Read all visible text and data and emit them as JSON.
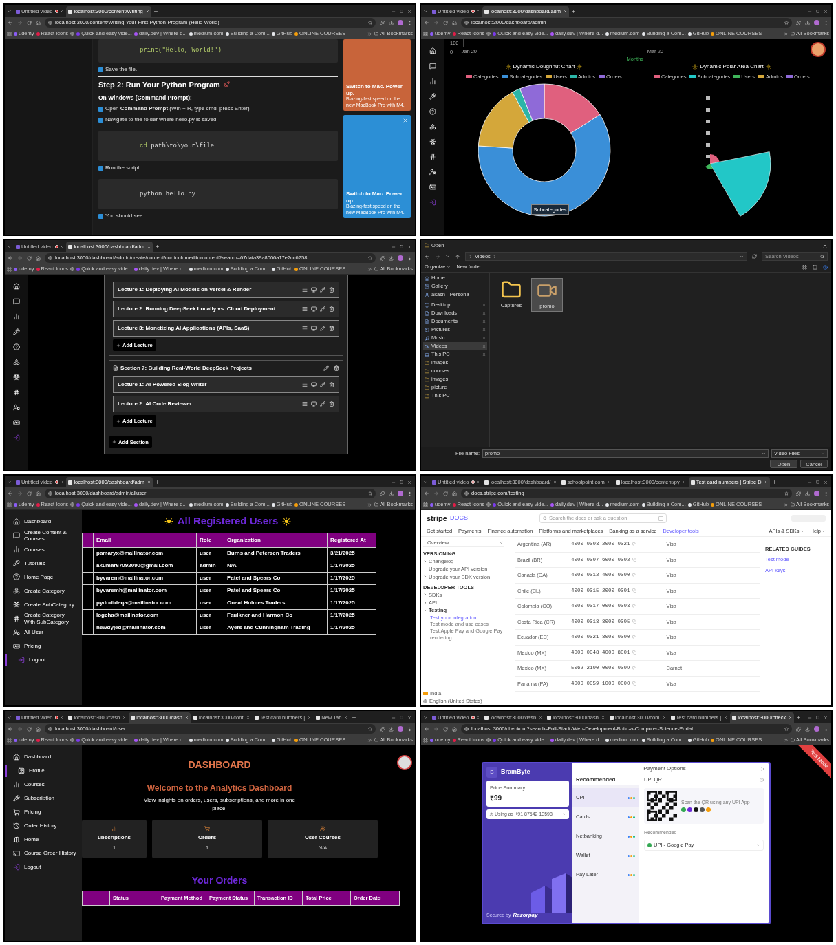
{
  "panels": [
    {
      "kind": "tutorial",
      "browser": {
        "tabs": [
          {
            "title": "Untitled video",
            "selected": false,
            "recording": true
          },
          {
            "title": "localhost:3000/content/Writing",
            "selected": true,
            "recording": false
          }
        ],
        "url": "localhost:3000/content/Writing-Your-First-Python-Program-(Hello-World)",
        "bookmarks": [
          "udemy",
          "React Icons",
          "Quick and easy vide...",
          "daily.dev | Where d...",
          "medium.com",
          "Building a Com...",
          "GitHub",
          "ONLINE COURSES"
        ],
        "all_bookmarks": "All Bookmarks"
      },
      "blocks": [
        {
          "kind": "code",
          "tokens": [
            {
              "text": "print(\"Hello, World!\")",
              "keyword": true
            }
          ]
        },
        {
          "kind": "step",
          "text": "Save the file."
        },
        {
          "kind": "heading",
          "text": "Step 2: Run Your Python Program"
        },
        {
          "kind": "subheading",
          "text": "On Windows (Command Prompt):"
        },
        {
          "kind": "step",
          "text": "Open **Command Prompt** (Win + R, type cmd, press Enter)."
        },
        {
          "kind": "step",
          "text": "Navigate to the folder where hello.py is saved:"
        },
        {
          "kind": "code",
          "tokens": [
            {
              "text": "cd",
              "keyword": true
            },
            {
              "text": " path\\to\\your\\file",
              "keyword": false
            }
          ]
        },
        {
          "kind": "step",
          "text": "Run the script:"
        },
        {
          "kind": "code",
          "tokens": [
            {
              "text": "python hello.py",
              "keyword": false
            }
          ]
        },
        {
          "kind": "step",
          "text": "You should see:"
        }
      ],
      "ads": [
        {
          "title": "Switch to Mac. Power up.",
          "text": "Blazing-fast speed on the new MacBook Pro with M4.",
          "closable": false
        },
        {
          "title": "Switch to Mac. Power up.",
          "text": "Blazing-fast speed on the new MacBook Pro with M4.",
          "closable": true
        }
      ]
    },
    {
      "kind": "charts",
      "browser": {
        "tabs": [
          {
            "title": "Untitled video",
            "selected": false,
            "recording": true
          },
          {
            "title": "localhost:3000/dashboard/adm",
            "selected": true,
            "recording": false
          }
        ],
        "url": "localhost:3000/dashboard/admin",
        "bookmarks": [
          "udemy",
          "React Icons",
          "Quick and easy vide...",
          "daily.dev | Where d...",
          "medium.com",
          "Building a Com...",
          "GitHub",
          "ONLINE COURSES"
        ],
        "all_bookmarks": "All Bookmarks"
      },
      "top_chart": {
        "yticks": [
          "100",
          "0"
        ],
        "xticks": [
          "Jan 20",
          "Mar 20"
        ],
        "xlabel": "Months"
      },
      "charts": [
        {
          "kind": "donut",
          "title": "Dynamic Doughnut Chart",
          "tooltip": "Subcategories",
          "legend": [
            {
              "label": "Categories",
              "color": "#e0607e"
            },
            {
              "label": "Subcategories",
              "color": "#3a8fd8"
            },
            {
              "label": "Users",
              "color": "#d4a73a"
            },
            {
              "label": "Admins",
              "color": "#2bb5a8"
            },
            {
              "label": "Orders",
              "color": "#8f6ad8"
            }
          ]
        },
        {
          "kind": "polar",
          "title": "Dynamic Polar Area Chart",
          "legend": [
            {
              "label": "Categories",
              "color": "#e0607e"
            },
            {
              "label": "Subcategories",
              "color": "#22c7c7"
            },
            {
              "label": "Users",
              "color": "#3fb55a"
            },
            {
              "label": "Admins",
              "color": "#d4a73a"
            },
            {
              "label": "Orders",
              "color": "#8f6ad8"
            }
          ]
        }
      ]
    },
    {
      "kind": "curriculum",
      "browser": {
        "tabs": [
          {
            "title": "Untitled video",
            "selected": false,
            "recording": true
          },
          {
            "title": "localhost:3000/dashboard/adm",
            "selected": true,
            "recording": false
          }
        ],
        "url": "localhost:3000/dashboard/admin/create/content/curriculumeditorcontent?search=67dafa39a8006a17e2cc6258",
        "bookmarks": [
          "udemy",
          "React Icons",
          "Quick and easy vide...",
          "daily.dev | Where d...",
          "medium.com",
          "Building a Com...",
          "GitHub",
          "ONLINE COURSES"
        ],
        "all_bookmarks": "All Bookmarks"
      },
      "sections": [
        {
          "lectures": [
            "Lecture 1: Deploying AI Models on Vercel & Render",
            "Lecture 2: Running DeepSeek Locally vs. Cloud Deployment",
            "Lecture 3: Monetizing AI Applications (APIs, SaaS)"
          ],
          "add_lecture": "Add Lecture"
        },
        {
          "title": "Section 7: Building Real-World DeepSeek Projects",
          "lectures": [
            "Lecture 1: AI-Powered Blog Writer",
            "Lecture 2: AI Code Reviewer"
          ],
          "add_lecture": "Add Lecture"
        }
      ],
      "add_section": "Add Section"
    },
    {
      "kind": "file_dialog",
      "title": "Open",
      "path": "Videos",
      "search_placeholder": "Search Videos",
      "toolbar": [
        "Organize",
        "New folder"
      ],
      "nav": [
        {
          "label": "Home",
          "selected": false,
          "pinned": false
        },
        {
          "label": "Gallery",
          "selected": false,
          "pinned": false
        },
        {
          "label": "akash - Persona",
          "selected": false,
          "pinned": false
        },
        {
          "label": "Desktop",
          "selected": false,
          "pinned": true
        },
        {
          "label": "Downloads",
          "selected": false,
          "pinned": true
        },
        {
          "label": "Documents",
          "selected": false,
          "pinned": true
        },
        {
          "label": "Pictures",
          "selected": false,
          "pinned": true
        },
        {
          "label": "Music",
          "selected": false,
          "pinned": true
        },
        {
          "label": "Videos",
          "selected": true,
          "pinned": true
        },
        {
          "label": "This PC",
          "selected": false,
          "pinned": true
        },
        {
          "label": "images",
          "selected": false,
          "pinned": false
        },
        {
          "label": "courses",
          "selected": false,
          "pinned": false
        },
        {
          "label": "images",
          "selected": false,
          "pinned": false
        },
        {
          "label": "picture",
          "selected": false,
          "pinned": false
        },
        {
          "label": "This PC",
          "selected": false,
          "pinned": false
        }
      ],
      "files": [
        {
          "name": "Captures",
          "kind": "folder",
          "selected": false
        },
        {
          "name": "promo",
          "kind": "video",
          "selected": true
        }
      ],
      "file_name_label": "File name:",
      "file_name": "promo",
      "file_type": "Video Files",
      "buttons": [
        "Open",
        "Cancel"
      ]
    },
    {
      "kind": "users",
      "browser": {
        "tabs": [
          {
            "title": "Untitled video",
            "selected": false,
            "recording": true
          },
          {
            "title": "localhost:3000/dashboard/adm",
            "selected": true,
            "recording": false
          }
        ],
        "url": "localhost:3000/dashboard/admin/alluser",
        "bookmarks": [
          "udemy",
          "React Icons",
          "Quick and easy vide...",
          "daily.dev | Where d...",
          "medium.com",
          "Building a Com...",
          "GitHub",
          "ONLINE COURSES"
        ],
        "all_bookmarks": "All Bookmarks"
      },
      "sidebar": [
        {
          "label": "Dashboard",
          "selected": false
        },
        {
          "label": "Create Content & Courses",
          "selected": false
        },
        {
          "label": "Courses",
          "selected": false
        },
        {
          "label": "Tutorials",
          "selected": false
        },
        {
          "label": "Home Page",
          "selected": false
        },
        {
          "label": "Create Category",
          "selected": false
        },
        {
          "label": "Create SubCategory",
          "selected": false
        },
        {
          "label": "Create Category With SubCategory",
          "selected": false
        },
        {
          "label": "All User",
          "selected": false
        },
        {
          "label": "Pricing",
          "selected": false
        },
        {
          "label": "Logout",
          "selected": true
        }
      ],
      "title": "All Registered Users",
      "table": {
        "columns": [
          "Email",
          "Role",
          "Organization",
          "Registered At"
        ],
        "rows": [
          [
            "pamaryx@mailinator.com",
            "user",
            "Burns and Petersen Traders",
            "3/21/2025"
          ],
          [
            "akumar67092090@gmail.com",
            "admin",
            "N/A",
            "1/17/2025"
          ],
          [
            "byvarem@mailinator.com",
            "user",
            "Patel and Spears Co",
            "1/17/2025"
          ],
          [
            "byvaremh@mailinator.com",
            "user",
            "Patel and Spears Co",
            "1/17/2025"
          ],
          [
            "pydodideqa@mailinator.com",
            "user",
            "Oneal Holmes Traders",
            "1/17/2025"
          ],
          [
            "logcha@mailinator.com",
            "user",
            "Faulkner and Harmon Co",
            "1/17/2025"
          ],
          [
            "hewdyjed@mailinator.com",
            "user",
            "Ayers and Cunningham Trading",
            "1/17/2025"
          ]
        ]
      }
    },
    {
      "kind": "stripe",
      "browser": {
        "tabs": [
          {
            "title": "Untitled video",
            "selected": false,
            "recording": true
          },
          {
            "title": "localhost:3000/dashboard/",
            "selected": false,
            "recording": false
          },
          {
            "title": "schoolpoint.com",
            "selected": false,
            "recording": false
          },
          {
            "title": "localhost:3000/content/py",
            "selected": false,
            "recording": false
          },
          {
            "title": "Test card numbers | Stripe D",
            "selected": true,
            "recording": false
          }
        ],
        "url": "docs.stripe.com/testing",
        "bookmarks": [
          "udemy",
          "React Icons",
          "Quick and easy vide...",
          "daily.dev | Where d...",
          "medium.com",
          "Building a Com...",
          "GitHub",
          "ONLINE COURSES"
        ],
        "all_bookmarks": "All Bookmarks"
      },
      "logo": "stripe",
      "logo_suffix": "DOCS",
      "search_placeholder": "Search the docs or ask a question",
      "nav": [
        {
          "label": "Get started",
          "selected": false
        },
        {
          "label": "Payments",
          "selected": false
        },
        {
          "label": "Finance automation",
          "selected": false
        },
        {
          "label": "Platforms and marketplaces",
          "selected": false
        },
        {
          "label": "Banking as a service",
          "selected": false
        },
        {
          "label": "Developer tools",
          "selected": true
        }
      ],
      "nav_right": [
        "APIs & SDKs",
        "Help"
      ],
      "sidebar": {
        "overview": "Overview",
        "groups": [
          {
            "title": "VERSIONING",
            "items": [
              {
                "label": "Changelog",
                "expanded": false
              },
              {
                "label": "Upgrade your API version"
              },
              {
                "label": "Upgrade your SDK version",
                "expanded": false
              }
            ]
          },
          {
            "title": "DEVELOPER TOOLS",
            "items": [
              {
                "label": "SDKs",
                "expanded": false
              },
              {
                "label": "API",
                "expanded": false
              },
              {
                "label": "Testing",
                "expanded": true,
                "children": [
                  {
                    "label": "Test your integration",
                    "selected": true
                  },
                  {
                    "label": "Test mode and use cases",
                    "selected": false
                  },
                  {
                    "label": "Test Apple Pay and Google Pay rendering",
                    "selected": false
                  }
                ]
              }
            ]
          }
        ],
        "country": "India",
        "language": "English (United States)"
      },
      "rows": [
        [
          "Argentina (AR)",
          "4000 0003 2000 0021",
          "Visa"
        ],
        [
          "Brazil (BR)",
          "4000 0007 6000 0002",
          "Visa"
        ],
        [
          "Canada (CA)",
          "4000 0012 4000 0000",
          "Visa"
        ],
        [
          "Chile (CL)",
          "4000 0015 2000 0001",
          "Visa"
        ],
        [
          "Colombia (CO)",
          "4000 0017 0000 0003",
          "Visa"
        ],
        [
          "Costa Rica (CR)",
          "4000 0018 8000 0005",
          "Visa"
        ],
        [
          "Ecuador (EC)",
          "4000 0021 8000 0000",
          "Visa"
        ],
        [
          "Mexico (MX)",
          "4000 0048 4000 8001",
          "Visa"
        ],
        [
          "Mexico (MX)",
          "5062 2100 0000 0009",
          "Carnet"
        ],
        [
          "Panama (PA)",
          "4000 0059 1000 0000",
          "Visa"
        ]
      ],
      "related": {
        "title": "RELATED GUIDES",
        "links": [
          "Test mode",
          "API keys"
        ]
      }
    },
    {
      "kind": "user_dashboard",
      "browser": {
        "tabs": [
          {
            "title": "Untitled video",
            "selected": false,
            "recording": true
          },
          {
            "title": "localhost:3000/dash",
            "selected": false,
            "recording": false
          },
          {
            "title": "localhost:3000/dash",
            "selected": true,
            "recording": false
          },
          {
            "title": "localhost:3000/cont",
            "selected": false,
            "recording": false
          },
          {
            "title": "Test card numbers |",
            "selected": false,
            "recording": false
          },
          {
            "title": "New Tab",
            "selected": false,
            "recording": false
          }
        ],
        "url": "localhost:3000/dashboard/user",
        "bookmarks": [
          "udemy",
          "React Icons",
          "Quick and easy vide...",
          "daily.dev | Where d...",
          "medium.com",
          "Building a Com...",
          "GitHub",
          "ONLINE COURSES"
        ],
        "all_bookmarks": "All Bookmarks"
      },
      "sidebar": [
        {
          "label": "Dashboard",
          "selected": false
        },
        {
          "label": "Profile",
          "selected": true
        },
        {
          "label": "Courses",
          "selected": false
        },
        {
          "label": "Subscription",
          "selected": false
        },
        {
          "label": "Pricing",
          "selected": false
        },
        {
          "label": "Order History",
          "selected": false
        },
        {
          "label": "Home",
          "selected": false
        },
        {
          "label": "Course Order History",
          "selected": false
        },
        {
          "label": "Logout",
          "selected": false
        }
      ],
      "title": "DASHBOARD",
      "welcome": "Welcome to the Analytics Dashboard",
      "intro": "View insights on orders, users, subscriptions, and more in one place.",
      "cards": [
        {
          "title": "ubscriptions",
          "value": "1"
        },
        {
          "title": "Orders",
          "value": "1"
        },
        {
          "title": "User Courses",
          "value": "N/A"
        }
      ],
      "orders_title": "Your Orders",
      "orders_columns": [
        "Status",
        "Payment Method",
        "Payment Status",
        "Transaction ID",
        "Total Price",
        "Order Date"
      ]
    },
    {
      "kind": "checkout",
      "browser": {
        "tabs": [
          {
            "title": "Untitled video",
            "selected": false,
            "recording": true
          },
          {
            "title": "localhost:3000/dash",
            "selected": false,
            "recording": false
          },
          {
            "title": "localhost:3000/dash",
            "selected": false,
            "recording": false
          },
          {
            "title": "localhost:3000/com",
            "selected": false,
            "recording": false
          },
          {
            "title": "Test card numbers |",
            "selected": false,
            "recording": false
          },
          {
            "title": "localhost:3000/check",
            "selected": true,
            "recording": false
          }
        ],
        "url": "localhost:3000/checkout?search=Full-Stack-Web-Development-Build-a-Computer-Science-Portal",
        "bookmarks": [
          "udemy",
          "React Icons",
          "Quick and easy vide...",
          "daily.dev | Where d...",
          "medium.com",
          "Building a Com...",
          "GitHub",
          "ONLINE COURSES"
        ],
        "all_bookmarks": "All Bookmarks"
      },
      "ribbon": "Test Mode",
      "brand_initial": "B",
      "brand": "BrainByte",
      "price_label": "Price Summary",
      "price": "₹99",
      "contact": "Using as +91 87542 13598",
      "secured_by": "Secured by",
      "provider": "Razorpay",
      "options_title": "Payment Options",
      "methods_title": "Recommended",
      "methods": [
        {
          "label": "UPI",
          "selected": true
        },
        {
          "label": "Cards",
          "selected": false
        },
        {
          "label": "Netbanking",
          "selected": false
        },
        {
          "label": "Wallet",
          "selected": false
        },
        {
          "label": "Pay Later",
          "selected": false
        }
      ],
      "qr_title": "UPI QR",
      "qr_hint": "Scan the QR using any UPI App",
      "recommended_title": "Recommended",
      "recommended": "UPI - Google Pay"
    }
  ]
}
